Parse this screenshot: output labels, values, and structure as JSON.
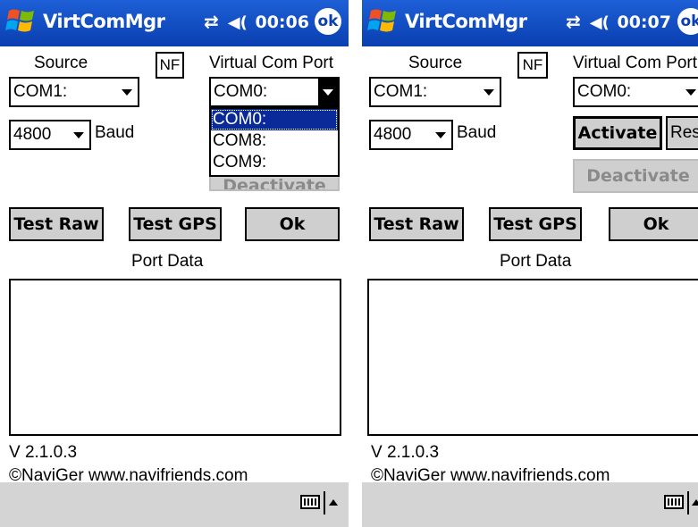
{
  "title_bar": {
    "app_title": "VirtComMgr"
  },
  "screen1": {
    "time": "00:06",
    "ok_label": "ok"
  },
  "screen2": {
    "time": "00:07",
    "ok_label": "ok"
  },
  "form": {
    "source_label": "Source",
    "nf_label": "NF",
    "virtual_port_label": "Virtual Com Port",
    "source_value": "COM1:",
    "baud_value": "4800",
    "baud_label": "Baud",
    "virtual_port_value": "COM0:",
    "virtual_port_options": [
      "COM0:",
      "COM8:",
      "COM9:"
    ],
    "activate_label": "Activate",
    "reset_label": "Res",
    "deactivate_label": "Deactivate",
    "test_raw_label": "Test Raw",
    "test_gps_label": "Test GPS",
    "ok_label": "Ok",
    "port_data_label": "Port Data",
    "version": "V 2.1.0.3",
    "credits": "©NaviGer  www.navifriends.com"
  },
  "icons": [
    "windows-start-icon",
    "connectivity-icon",
    "speaker-icon",
    "keyboard-icon",
    "input-menu-arrow-icon"
  ],
  "colors": {
    "title_bar": "#0a3fb0",
    "selection": "#0a2a9a",
    "button_face": "#cfcfcf",
    "bottom_bar": "#d4d4d4"
  }
}
